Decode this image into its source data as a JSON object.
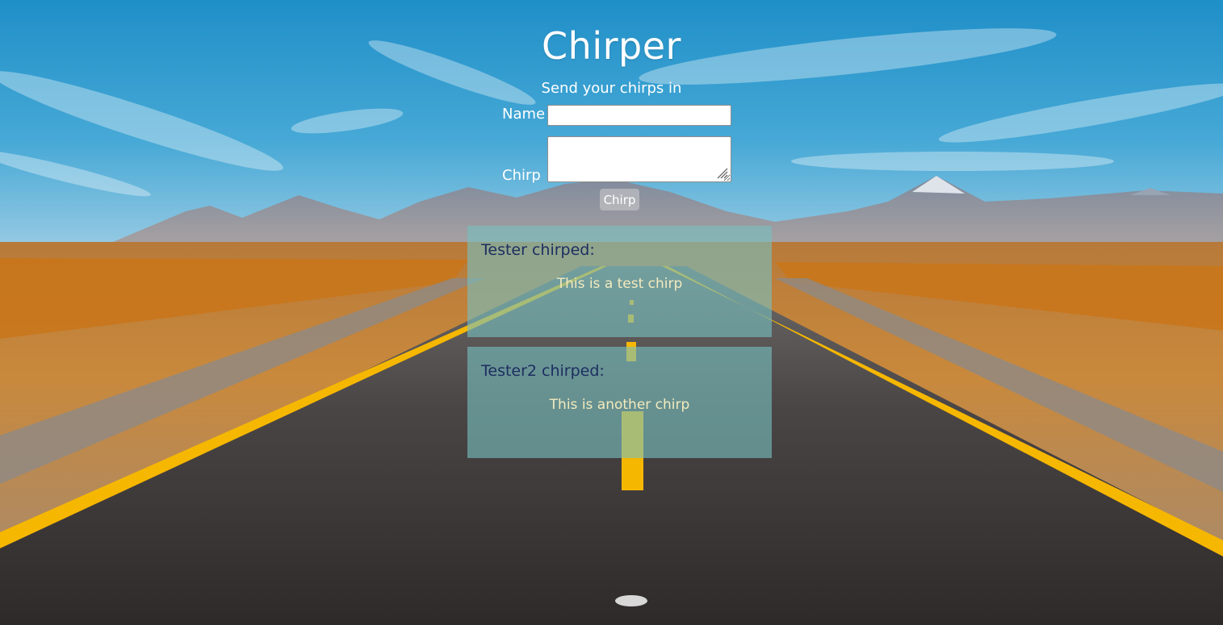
{
  "header": {
    "title": "Chirper",
    "subtitle": "Send your chirps in"
  },
  "form": {
    "name_label": "Name",
    "name_value": "",
    "chirp_label": "Chirp",
    "chirp_value": "",
    "submit_label": "Chirp"
  },
  "chirps": [
    {
      "author_line": "Tester chirped:",
      "message": "This is a test chirp"
    },
    {
      "author_line": "Tester2 chirped:",
      "message": "This is another chirp"
    }
  ],
  "colors": {
    "card_background": "#78bebe",
    "author_text": "#1c2e60",
    "message_text": "#f3ebbd",
    "sky": "#2a9bd0",
    "road": "#3a3636",
    "road_line": "#f6b700"
  }
}
